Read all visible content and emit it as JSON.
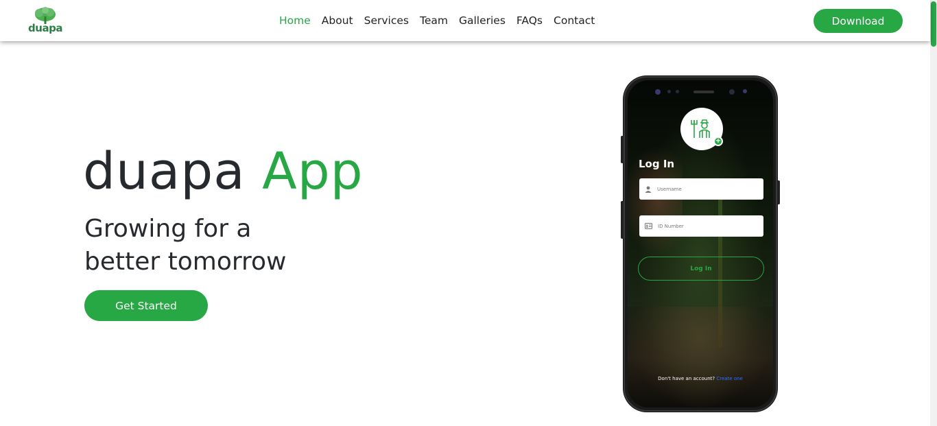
{
  "brand": {
    "logo_text": "duapa",
    "logo_icon": "tree-icon",
    "accent_color": "#28a745"
  },
  "nav": {
    "items": [
      {
        "label": "Home",
        "active": true
      },
      {
        "label": "About",
        "active": false
      },
      {
        "label": "Services",
        "active": false
      },
      {
        "label": "Team",
        "active": false
      },
      {
        "label": "Galleries",
        "active": false
      },
      {
        "label": "FAQs",
        "active": false
      },
      {
        "label": "Contact",
        "active": false
      }
    ],
    "download_label": "Download"
  },
  "hero": {
    "title_main": "duapa",
    "title_accent": "App",
    "subtitle_line1": "Growing for a",
    "subtitle_line2": "better tomorrow",
    "cta_label": "Get Started"
  },
  "phone": {
    "login_title": "Log In",
    "username_placeholder": "Username",
    "id_placeholder": "ID Number",
    "login_button": "Log In",
    "signup_prompt": "Don't have an account?",
    "signup_link": "Create one",
    "avatar_icon": "farmer-icon"
  }
}
